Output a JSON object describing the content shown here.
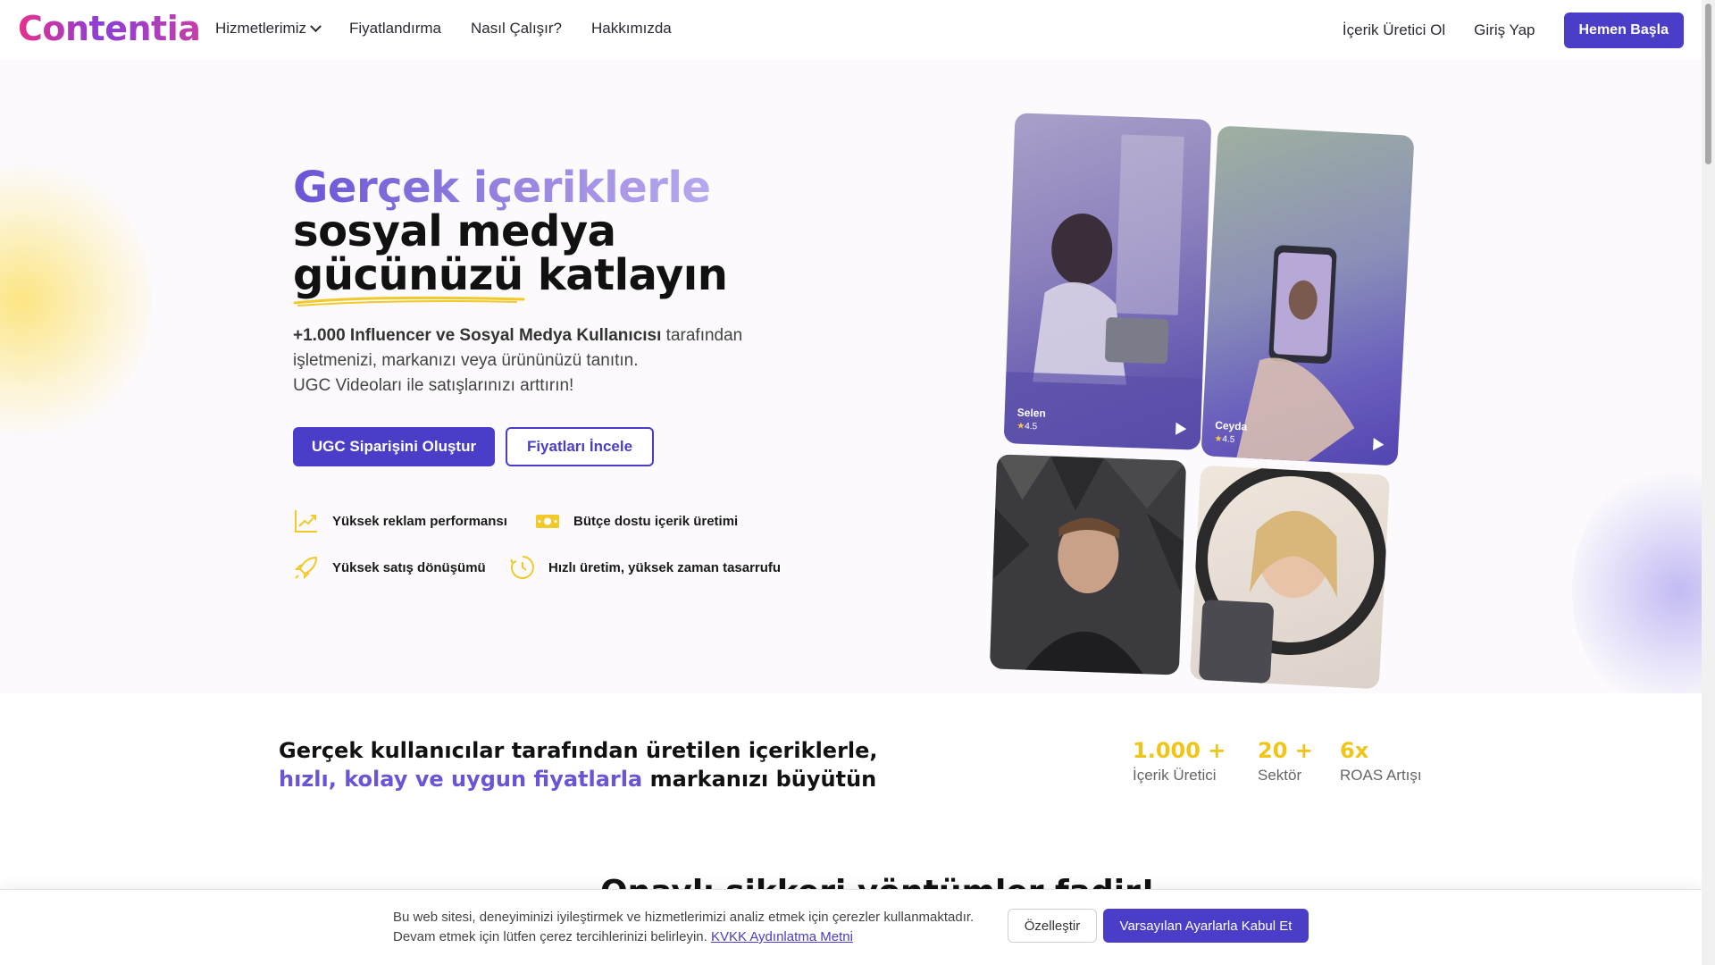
{
  "nav": {
    "logo": "Contentia",
    "links": [
      "Hizmetlerimiz",
      "Fiyatlandırma",
      "Nasıl Çalışır?",
      "Hakkımızda"
    ],
    "creator_link": "İçerik Üretici Ol",
    "login": "Giriş Yap",
    "cta": "Hemen Başla"
  },
  "hero": {
    "headline_accent": "Gerçek içeriklerle",
    "headline_rest": "sosyal medya gücünüzü katlayın",
    "sub_bold": "+1.000 Influencer ve Sosyal Medya Kullanıcısı",
    "sub_line1": "tarafından",
    "sub_line2": "işletmenizi, markanızı veya ürününüzü tanıtın.",
    "sub_line3": "UGC Videoları ile satışlarınızı arttırın!",
    "btn_primary": "UGC Siparişini Oluştur",
    "btn_secondary": "Fiyatları İncele",
    "features": [
      {
        "icon": "chart-up-icon",
        "label": "Yüksek reklam performansı"
      },
      {
        "icon": "money-icon",
        "label": "Bütçe dostu içerik üretimi"
      },
      {
        "icon": "rocket-icon",
        "label": "Yüksek satış dönüşümü"
      },
      {
        "icon": "clock-icon",
        "label": "Hızlı üretim, yüksek zaman tasarrufu"
      }
    ],
    "creators": [
      {
        "name": "Selen",
        "rating": "4.5"
      },
      {
        "name": "Ceyda",
        "rating": "4.5"
      }
    ]
  },
  "stats": {
    "title_line1": "Gerçek kullanıcılar tarafından üretilen içeriklerle,",
    "title_accent": "hızlı, kolay ve uygun fiyatlarla",
    "title_rest": "markanızı büyütün",
    "items": [
      {
        "value": "1.000 +",
        "label": "İçerik Üretici"
      },
      {
        "value": "20 +",
        "label": "Sektör"
      },
      {
        "value": "6x",
        "label": "ROAS Artışı"
      }
    ]
  },
  "next_heading": "Onaylı şikkeri yöntümler fadir!",
  "cookie": {
    "text": "Bu web sitesi, deneyiminizi iyileştirmek ve hizmetlerimizi analiz etmek için çerezler kullanmaktadır. Devam etmek için lütfen çerez tercihlerinizi belirleyin.",
    "link": "KVKK Aydınlatma Metni",
    "customize": "Özelleştir",
    "accept": "Varsayılan Ayarlarla Kabul Et"
  },
  "colors": {
    "primary": "#4a3ec8",
    "accent_purple": "#6b54d6",
    "stat_yellow": "#f0c419"
  }
}
